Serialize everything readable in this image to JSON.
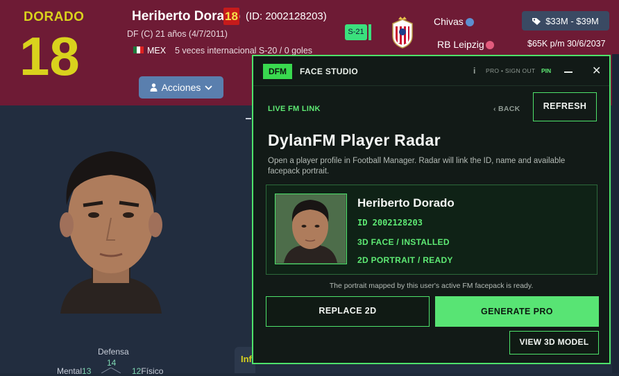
{
  "profile": {
    "surname_tag": "DORADO",
    "shirt_number": "18",
    "name": "Heriberto Dorado",
    "number_badge": "18",
    "id_text": "(ID: 2002128203)",
    "position_age": "DF (C)  21 años (4/7/2011)",
    "nationality": "MEX",
    "caps": "5 veces internacional S-20 / 0 goles",
    "actions_label": "Acciones",
    "squad_badge": "S-21",
    "club_primary": "Chivas",
    "club_secondary": "RB Leipzig",
    "value_range": "$33M - $39M",
    "wage_contract": "$65K p/m 30/6/2037",
    "attr_defense_label": "Defensa",
    "attr_defense_value": "14",
    "attr_mental_label": "Mental",
    "attr_mental_value": "13",
    "attr_physical_label": "Físico",
    "attr_physical_value": "12",
    "info_tab_label": "Inf"
  },
  "overlay": {
    "logo": "DFM",
    "app_name": "FACE STUDIO",
    "info_icon": "i",
    "pro_signout": "PRO • SIGN OUT",
    "pin_label": "PIN",
    "live_link": "LIVE FM LINK",
    "back_label": "‹  BACK",
    "refresh_label": "REFRESH",
    "title": "DylanFM Player Radar",
    "description": "Open a player profile in Football Manager. Radar will link the ID, name and available facepack portrait.",
    "card": {
      "player_name": "Heriberto Dorado",
      "id_line": "ID  2002128203",
      "face_status": "3D FACE / INSTALLED",
      "portrait_status": "2D PORTRAIT / READY"
    },
    "note": "The portrait mapped by this user's active FM facepack is ready.",
    "replace_label": "REPLACE 2D",
    "generate_label": "GENERATE PRO",
    "view3d_label": "VIEW 3D MODEL"
  },
  "colors": {
    "header_maroon": "#6e1b35",
    "accent_yellow": "#d9d21d",
    "overlay_green": "#4ee36b",
    "overlay_bg": "#121a17"
  }
}
